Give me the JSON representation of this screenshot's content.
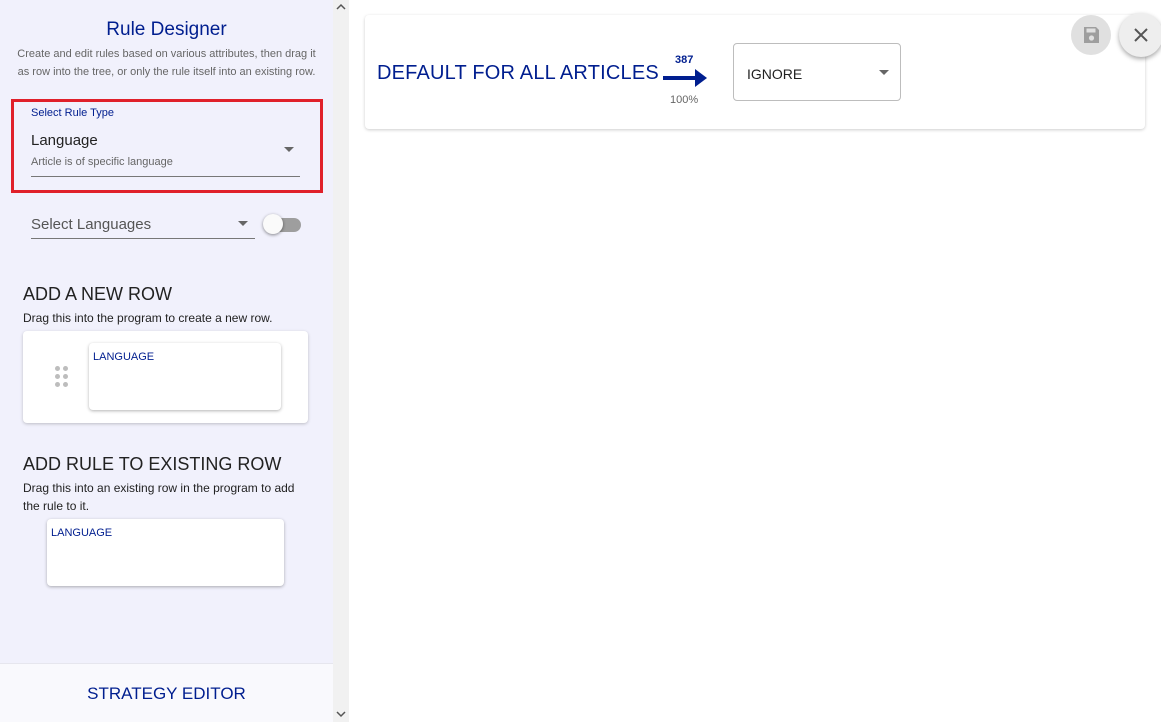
{
  "sidebar": {
    "title": "Rule Designer",
    "description": "Create and edit rules based on various attributes, then drag it as row into the tree, or only the rule itself into an existing row.",
    "rule_type": {
      "label": "Select Rule Type",
      "value": "Language",
      "sublabel": "Article is of specific language"
    },
    "languages_select": {
      "placeholder": "Select Languages"
    },
    "toggle": {
      "on": false
    },
    "new_row": {
      "heading": "ADD A NEW ROW",
      "subtitle": "Drag this into the program to create a new row.",
      "card_label": "LANGUAGE"
    },
    "existing_row": {
      "heading": "ADD RULE TO EXISTING ROW",
      "subtitle": "Drag this into an existing row in the program to add the rule to it.",
      "card_label": "LANGUAGE"
    },
    "footer_label": "STRATEGY EDITOR"
  },
  "main": {
    "default_label": "DEFAULT FOR ALL ARTICLES",
    "count": "387",
    "percent": "100%",
    "action_value": "IGNORE"
  },
  "icons": {
    "save": "save-icon",
    "close": "close-icon",
    "drag": "drag-handle-icon",
    "arrow": "arrow-right-icon"
  },
  "colors": {
    "accent": "#001e8f",
    "highlight_border": "#e0202a",
    "sidebar_bg": "#f1f1fc"
  }
}
